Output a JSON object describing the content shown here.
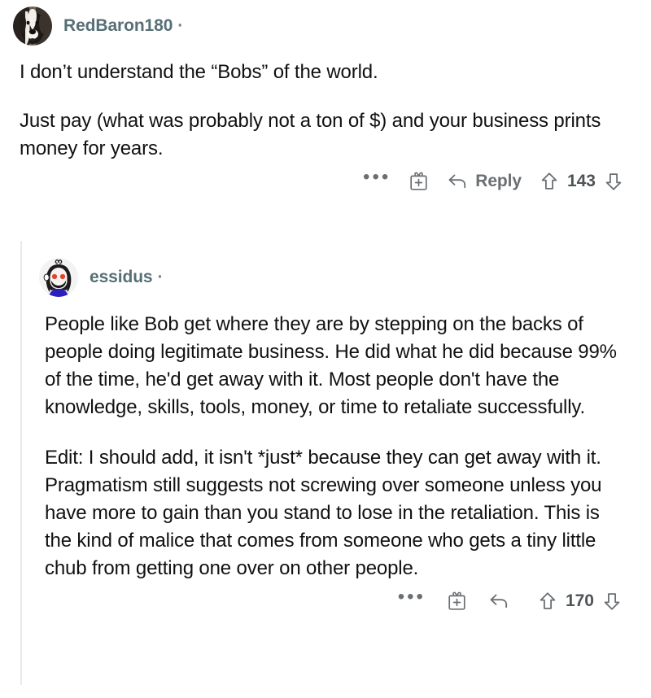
{
  "thread": {
    "root_comment": {
      "username": "RedBaron180",
      "separator": "·",
      "timestamp": "",
      "avatar_icon": "dog-photo-avatar",
      "paragraphs": [
        "I don’t understand the “Bobs” of the world.",
        "Just pay (what was probably not a ton of $) and your business prints money for years."
      ],
      "actions": {
        "more_label": "•••",
        "more_icon": "more-options-icon",
        "award_icon": "gift-award-icon",
        "reply_icon": "reply-arrow-icon",
        "reply_label": "Reply",
        "upvote_icon": "upvote-arrow-icon",
        "score": "143",
        "downvote_icon": "downvote-arrow-icon"
      }
    },
    "reply_comment": {
      "username": "essidus",
      "separator": "·",
      "timestamp": "",
      "avatar_icon": "snoo-bearded-avatar",
      "paragraphs": [
        "People like Bob get where they are by stepping on the backs of people doing legitimate business. He did what he did because 99% of the time, he'd get away with it. Most people don't have the knowledge, skills, tools, money, or time to retaliate successfully.",
        "Edit: I should add, it isn't *just* because they can get away with it. Pragmatism still suggests not screwing over someone unless you have more to gain than you stand to lose in the retaliation. This is the kind of malice that comes from someone who gets a tiny little chub from getting one over on other people."
      ],
      "actions": {
        "more_label": "•••",
        "more_icon": "more-options-icon",
        "award_icon": "gift-award-icon",
        "reply_icon": "reply-arrow-icon",
        "reply_label": "",
        "upvote_icon": "upvote-arrow-icon",
        "score": "170",
        "downvote_icon": "downvote-arrow-icon"
      }
    }
  },
  "colors": {
    "background": "#ffffff",
    "body_text": "#111111",
    "username_text": "#576f76",
    "action_text": "#6a6f73",
    "thread_line": "#e6e8e9",
    "avatar_shirt": "#2b1fbe"
  }
}
